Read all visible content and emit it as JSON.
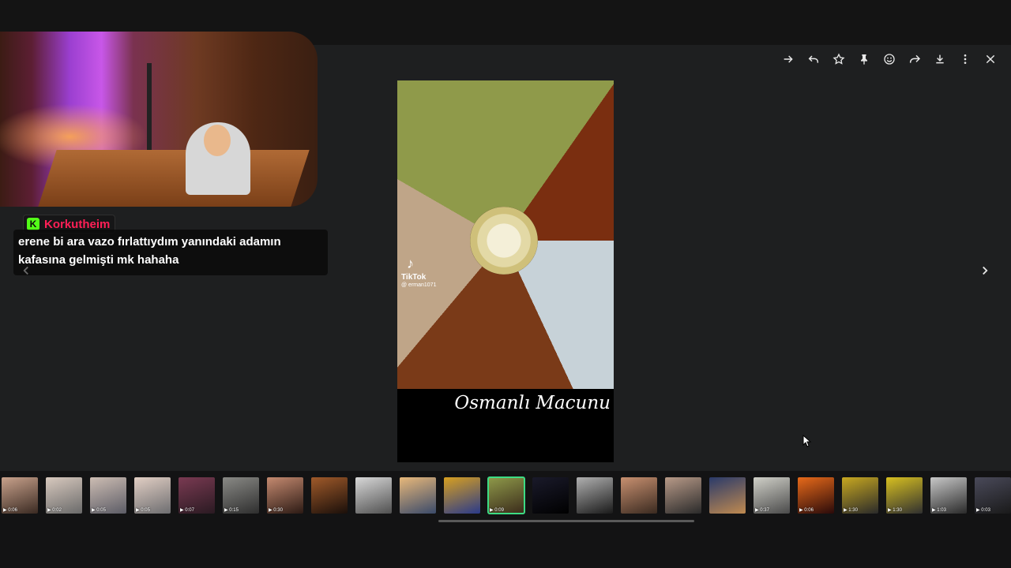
{
  "toolbar": {
    "buttons": [
      {
        "name": "forward-arrow-icon"
      },
      {
        "name": "reply-icon"
      },
      {
        "name": "star-icon"
      },
      {
        "name": "pin-icon"
      },
      {
        "name": "emoji-icon"
      },
      {
        "name": "share-icon"
      },
      {
        "name": "download-icon"
      },
      {
        "name": "more-options-icon"
      },
      {
        "name": "close-icon"
      }
    ]
  },
  "chat": {
    "username": "Korkutheim",
    "badge_letter": "K",
    "message": "erene bi ara vazo fırlattıydım yanındaki adamın kafasına gelmişti mk hahaha",
    "username_color": "#ff1f56",
    "badge_color": "#53fc18"
  },
  "media": {
    "tiktok_label": "TikTok",
    "tiktok_handle": "@ erman1071",
    "caption": "Osmanlı Macunu"
  },
  "filmstrip": {
    "selected_index": 11,
    "accent": "#3ddc84",
    "items": [
      {
        "duration": "0:06",
        "c1": "#c9a28c",
        "c2": "#3a2a22"
      },
      {
        "duration": "0:02",
        "c1": "#d8c9be",
        "c2": "#6a6a6a"
      },
      {
        "duration": "0:05",
        "c1": "#cdbdb3",
        "c2": "#5c5c66"
      },
      {
        "duration": "0:05",
        "c1": "#e2cfc4",
        "c2": "#6d6d70"
      },
      {
        "duration": "0:07",
        "c1": "#7a3a52",
        "c2": "#2a1a22"
      },
      {
        "duration": "0:15",
        "c1": "#8a8a86",
        "c2": "#2e2e2e"
      },
      {
        "duration": "0:30",
        "c1": "#c58a70",
        "c2": "#2c1a14"
      },
      {
        "duration": "",
        "c1": "#a05a2a",
        "c2": "#1a0f0a"
      },
      {
        "duration": "",
        "c1": "#d8d8d8",
        "c2": "#505050"
      },
      {
        "duration": "",
        "c1": "#e8b87a",
        "c2": "#3a4a6a"
      },
      {
        "duration": "",
        "c1": "#d8a020",
        "c2": "#2a3a8a"
      },
      {
        "duration": "0:09",
        "c1": "#8f9a4a",
        "c2": "#3a2a1a"
      },
      {
        "duration": "",
        "c1": "#1a1a2a",
        "c2": "#000000"
      },
      {
        "duration": "",
        "c1": "#b0b0b0",
        "c2": "#1a1a1a"
      },
      {
        "duration": "",
        "c1": "#c89070",
        "c2": "#3a2a20"
      },
      {
        "duration": "",
        "c1": "#b89a88",
        "c2": "#2a2a2a"
      },
      {
        "duration": "",
        "c1": "#2a3a6a",
        "c2": "#c08a50"
      },
      {
        "duration": "0:37",
        "c1": "#d0d0c8",
        "c2": "#4a4a4a"
      },
      {
        "duration": "0:06",
        "c1": "#e86a1a",
        "c2": "#2a0a0a"
      },
      {
        "duration": "1:30",
        "c1": "#c8a820",
        "c2": "#2a2a2a"
      },
      {
        "duration": "1:30",
        "c1": "#d8c020",
        "c2": "#303030"
      },
      {
        "duration": "1:03",
        "c1": "#c8c8c8",
        "c2": "#2a2a2a"
      },
      {
        "duration": "0:03",
        "c1": "#4a4a5a",
        "c2": "#1a1a1a"
      }
    ]
  }
}
